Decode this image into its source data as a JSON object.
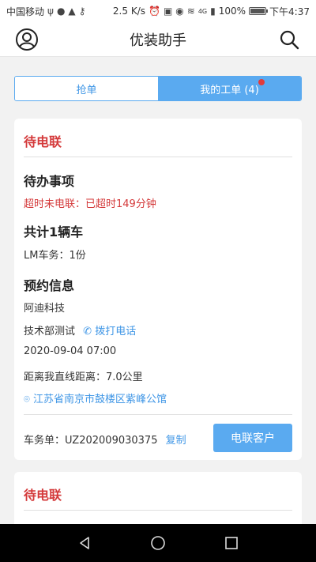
{
  "status_bar": {
    "carrier": "中国移动",
    "speed": "2.5 K/s",
    "network": "4G",
    "battery": "100%",
    "time": "下午4:37"
  },
  "header": {
    "title": "优装助手",
    "left_icon": "user-icon",
    "right_icon": "search-icon"
  },
  "tabs": [
    {
      "label": "抢单",
      "active": false
    },
    {
      "label": "我的工单 (4)",
      "active": true,
      "badge": "red-dot"
    }
  ],
  "orders": [
    {
      "status": "待电联",
      "todo_title": "待办事项",
      "overdue_text": "超时未电联：已超时149分钟",
      "vehicle_count_title": "共计1辆车",
      "service_line": "LM车务：1份",
      "appointment_title": "预约信息",
      "company": "阿迪科技",
      "contact_name": "技术部测试",
      "call_label": "拨打电话",
      "datetime": "2020-09-04 07:00",
      "distance": "距离我直线距离：7.0公里",
      "address": "江苏省南京市鼓楼区紫峰公馆",
      "order_no_label": "车务单：",
      "order_no": "UZ202009030375",
      "copy_label": "复制",
      "contact_button": "电联客户"
    },
    {
      "status": "待电联"
    }
  ],
  "colors": {
    "accent": "#5aaaf0",
    "link": "#3f96e6",
    "alert": "#d4393a"
  }
}
